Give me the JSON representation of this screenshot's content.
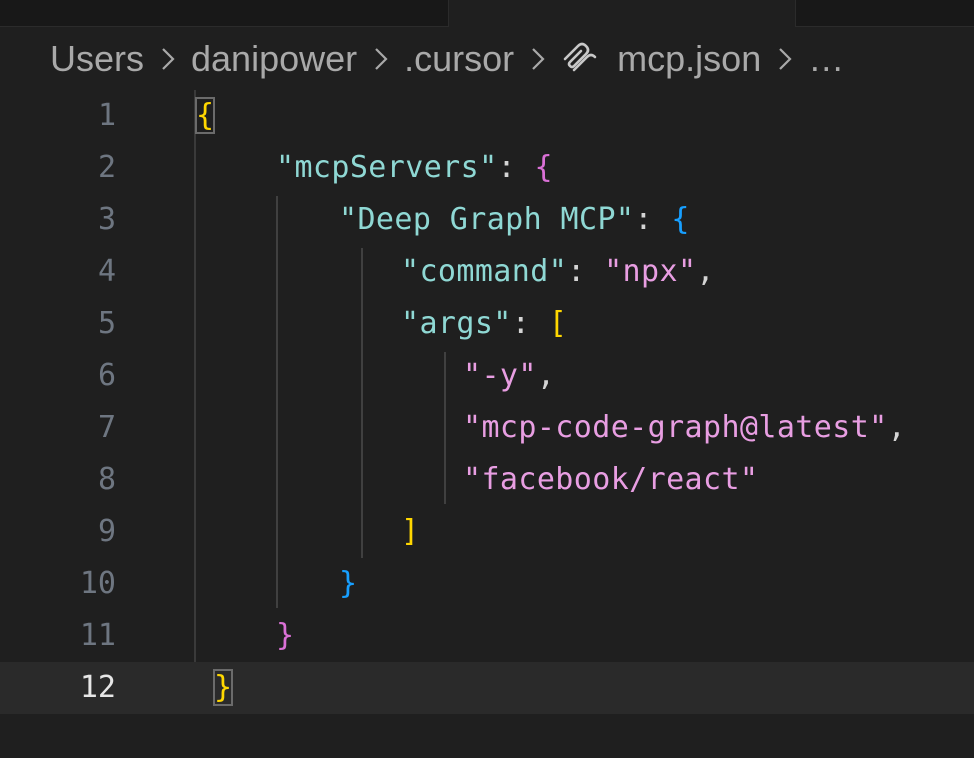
{
  "breadcrumb": {
    "items": [
      "Users",
      "danipower",
      ".cursor",
      "mcp.json",
      "…"
    ],
    "file_icon": "json-braces-icon"
  },
  "editor": {
    "current_line": 12,
    "lines": [
      {
        "n": "1"
      },
      {
        "n": "2",
        "key": "\"mcpServers\""
      },
      {
        "n": "3",
        "key": "\"Deep Graph MCP\""
      },
      {
        "n": "4",
        "key": "\"command\"",
        "value": "\"npx\""
      },
      {
        "n": "5",
        "key": "\"args\""
      },
      {
        "n": "6",
        "value": "\"-y\""
      },
      {
        "n": "7",
        "value": "\"mcp-code-graph@latest\""
      },
      {
        "n": "8",
        "value": "\"facebook/react\""
      },
      {
        "n": "9"
      },
      {
        "n": "10"
      },
      {
        "n": "11"
      },
      {
        "n": "12"
      }
    ],
    "tokens": {
      "open_brace": "{",
      "close_brace": "}",
      "open_bracket": "[",
      "close_bracket": "]",
      "colon": ": ",
      "comma": ","
    }
  },
  "colors": {
    "background": "#1f1f1f",
    "key": "#8fd8d4",
    "string": "#e89ee2",
    "bracket_level1": "#ffd700",
    "bracket_level2": "#da70d6",
    "bracket_level3": "#179fff"
  }
}
